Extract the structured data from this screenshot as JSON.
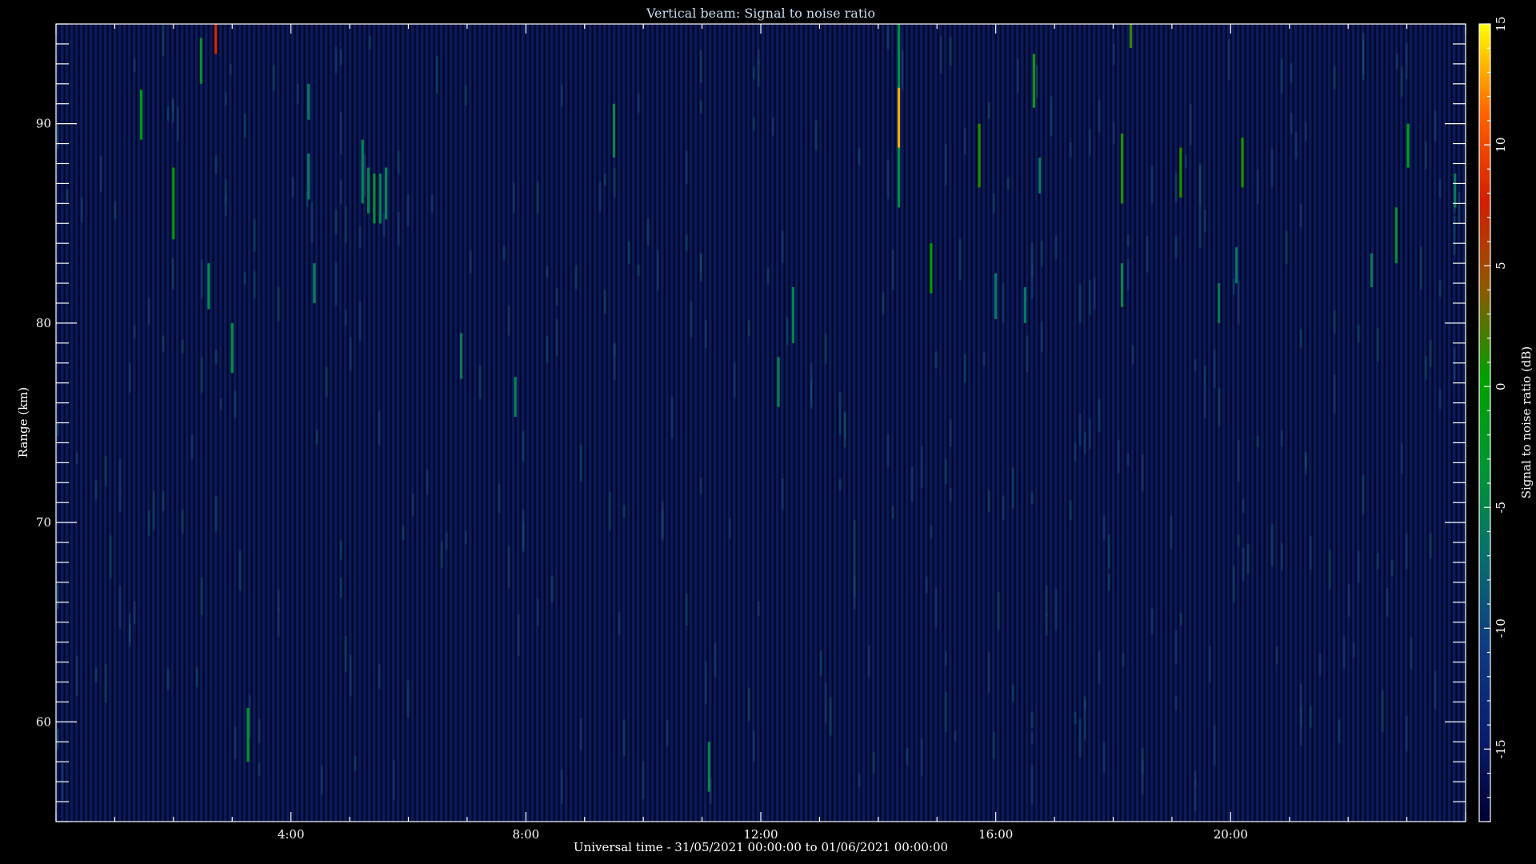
{
  "chart_data": {
    "type": "heatmap",
    "title": "Vertical beam: Signal to noise ratio",
    "xlabel": "Universal time - 31/05/2021 00:00:00 to 01/06/2021 00:00:00",
    "ylabel": "Range (km)",
    "colorbar_label": "Signal to noise ratio (dB)",
    "x_unit": "hours UT",
    "xlim": [
      0,
      24
    ],
    "ylim": [
      55,
      95
    ],
    "x_ticks": [
      4,
      8,
      12,
      16,
      20
    ],
    "x_tick_labels": [
      "4:00",
      "8:00",
      "12:00",
      "16:00",
      "20:00"
    ],
    "y_ticks": [
      60,
      70,
      80,
      90
    ],
    "y_tick_labels": [
      "60",
      "70",
      "80",
      "90"
    ],
    "clim": [
      -18,
      15
    ],
    "colorbar_ticks": [
      15,
      10,
      5,
      0,
      -5,
      -10,
      -15
    ],
    "colorbar_tick_labels": [
      "15",
      "10",
      "5",
      "0",
      "-5",
      "-10",
      "-15"
    ],
    "colormap": [
      "#000033",
      "#0a1e6e",
      "#0f3c82",
      "#0a6e6e",
      "#009632",
      "#00a000",
      "#8c5a00",
      "#d21e00",
      "#ff6400",
      "#ffff00"
    ],
    "background_snr_db": -15,
    "echoes": [
      {
        "t": 1.45,
        "r0": 89.2,
        "r1": 91.7,
        "snr": 0
      },
      {
        "t": 2.0,
        "r0": 84.2,
        "r1": 87.8,
        "snr": -1
      },
      {
        "t": 2.47,
        "r0": 92.0,
        "r1": 94.3,
        "snr": -4
      },
      {
        "t": 2.6,
        "r0": 80.7,
        "r1": 83.0,
        "snr": -4
      },
      {
        "t": 2.72,
        "r0": 93.5,
        "r1": 95.0,
        "snr": 8
      },
      {
        "t": 3.0,
        "r0": 77.5,
        "r1": 80.0,
        "snr": -4
      },
      {
        "t": 3.27,
        "r0": 58.0,
        "r1": 60.7,
        "snr": -3
      },
      {
        "t": 4.3,
        "r0": 90.2,
        "r1": 92.0,
        "snr": -6
      },
      {
        "t": 4.3,
        "r0": 86.2,
        "r1": 88.5,
        "snr": -6
      },
      {
        "t": 4.4,
        "r0": 81.0,
        "r1": 83.0,
        "snr": -5
      },
      {
        "t": 5.22,
        "r0": 86.0,
        "r1": 89.2,
        "snr": -5
      },
      {
        "t": 5.32,
        "r0": 85.5,
        "r1": 87.8,
        "snr": -5
      },
      {
        "t": 5.42,
        "r0": 85.0,
        "r1": 87.5,
        "snr": -4
      },
      {
        "t": 5.52,
        "r0": 85.0,
        "r1": 87.5,
        "snr": -5
      },
      {
        "t": 5.62,
        "r0": 85.2,
        "r1": 87.8,
        "snr": -5
      },
      {
        "t": 6.9,
        "r0": 77.2,
        "r1": 79.5,
        "snr": -6
      },
      {
        "t": 7.82,
        "r0": 75.3,
        "r1": 77.3,
        "snr": -5
      },
      {
        "t": 9.5,
        "r0": 88.3,
        "r1": 91.0,
        "snr": -5
      },
      {
        "t": 11.12,
        "r0": 56.5,
        "r1": 59.0,
        "snr": -5
      },
      {
        "t": 12.3,
        "r0": 75.8,
        "r1": 78.3,
        "snr": -5
      },
      {
        "t": 12.55,
        "r0": 79.0,
        "r1": 81.8,
        "snr": -5
      },
      {
        "t": 14.35,
        "r0": 85.8,
        "r1": 95.0,
        "snr": -4
      },
      {
        "t": 14.35,
        "r0": 88.8,
        "r1": 91.8,
        "snr": 13
      },
      {
        "t": 14.9,
        "r0": 81.5,
        "r1": 84.0,
        "snr": 0
      },
      {
        "t": 15.72,
        "r0": 86.8,
        "r1": 90.0,
        "snr": 1
      },
      {
        "t": 16.0,
        "r0": 80.2,
        "r1": 82.5,
        "snr": -6
      },
      {
        "t": 16.5,
        "r0": 80.0,
        "r1": 81.8,
        "snr": -6
      },
      {
        "t": 16.65,
        "r0": 90.8,
        "r1": 93.5,
        "snr": 1
      },
      {
        "t": 16.75,
        "r0": 86.5,
        "r1": 88.3,
        "snr": -6
      },
      {
        "t": 18.15,
        "r0": 86.0,
        "r1": 89.5,
        "snr": 1
      },
      {
        "t": 18.15,
        "r0": 80.8,
        "r1": 83.0,
        "snr": -5
      },
      {
        "t": 18.3,
        "r0": 93.8,
        "r1": 95.0,
        "snr": 2
      },
      {
        "t": 19.15,
        "r0": 86.3,
        "r1": 88.8,
        "snr": 1
      },
      {
        "t": 19.8,
        "r0": 80.0,
        "r1": 82.0,
        "snr": -6
      },
      {
        "t": 20.1,
        "r0": 82.0,
        "r1": 83.8,
        "snr": -6
      },
      {
        "t": 20.2,
        "r0": 86.8,
        "r1": 89.3,
        "snr": 1
      },
      {
        "t": 22.4,
        "r0": 81.8,
        "r1": 83.5,
        "snr": -6
      },
      {
        "t": 22.82,
        "r0": 83.0,
        "r1": 85.8,
        "snr": -4
      },
      {
        "t": 23.02,
        "r0": 87.8,
        "r1": 90.0,
        "snr": -1
      },
      {
        "t": 23.82,
        "r0": 85.8,
        "r1": 87.5,
        "snr": -6
      }
    ]
  }
}
